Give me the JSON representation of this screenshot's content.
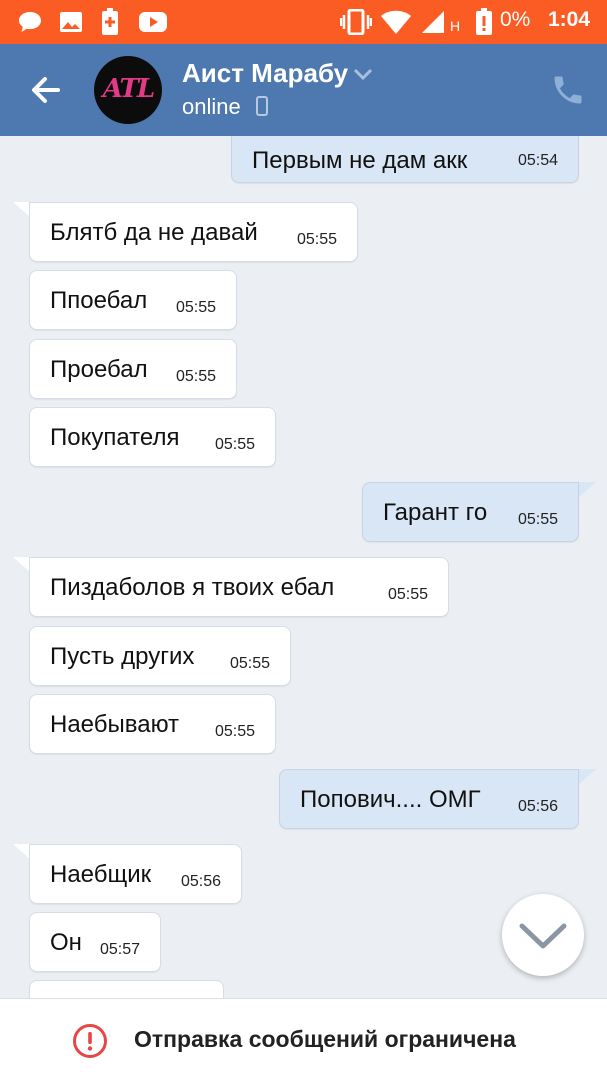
{
  "status_bar": {
    "battery_percent": "0%",
    "time": "1:04",
    "network_label": "H",
    "icons": [
      "chat-bubble-icon",
      "image-icon",
      "battery-plus-icon",
      "youtube-icon",
      "vibrate-icon",
      "wifi-icon",
      "signal-icon",
      "battery-alert-icon"
    ],
    "background": "#fb5c23"
  },
  "header": {
    "contact_name": "Аист Марабу",
    "status": "online",
    "avatar_text": "ATL",
    "background": "#4d79b0"
  },
  "messages": [
    {
      "dir": "out",
      "text": "Первым не дам акк",
      "time": "05:54"
    },
    {
      "dir": "in",
      "text": "Блятб да не давай",
      "time": "05:55"
    },
    {
      "dir": "in",
      "text": "Ппоебал",
      "time": "05:55"
    },
    {
      "dir": "in",
      "text": "Проебал",
      "time": "05:55"
    },
    {
      "dir": "in",
      "text": "Покупателя",
      "time": "05:55"
    },
    {
      "dir": "out",
      "text": "Гарант го",
      "time": "05:55"
    },
    {
      "dir": "in",
      "text": "Пиздаболов я твоих ебал",
      "time": "05:55"
    },
    {
      "dir": "in",
      "text": "Пусть других",
      "time": "05:55"
    },
    {
      "dir": "in",
      "text": "Наебывают",
      "time": "05:55"
    },
    {
      "dir": "out",
      "text": "Попович.... ОМГ",
      "time": "05:56"
    },
    {
      "dir": "in",
      "text": "Наебщик",
      "time": "05:56"
    },
    {
      "dir": "in",
      "text": "Он",
      "time": "05:57"
    }
  ],
  "bottom_bar": {
    "notice": "Отправка сообщений ограничена",
    "icon": "alert-circle-icon",
    "icon_color": "#e64646"
  }
}
